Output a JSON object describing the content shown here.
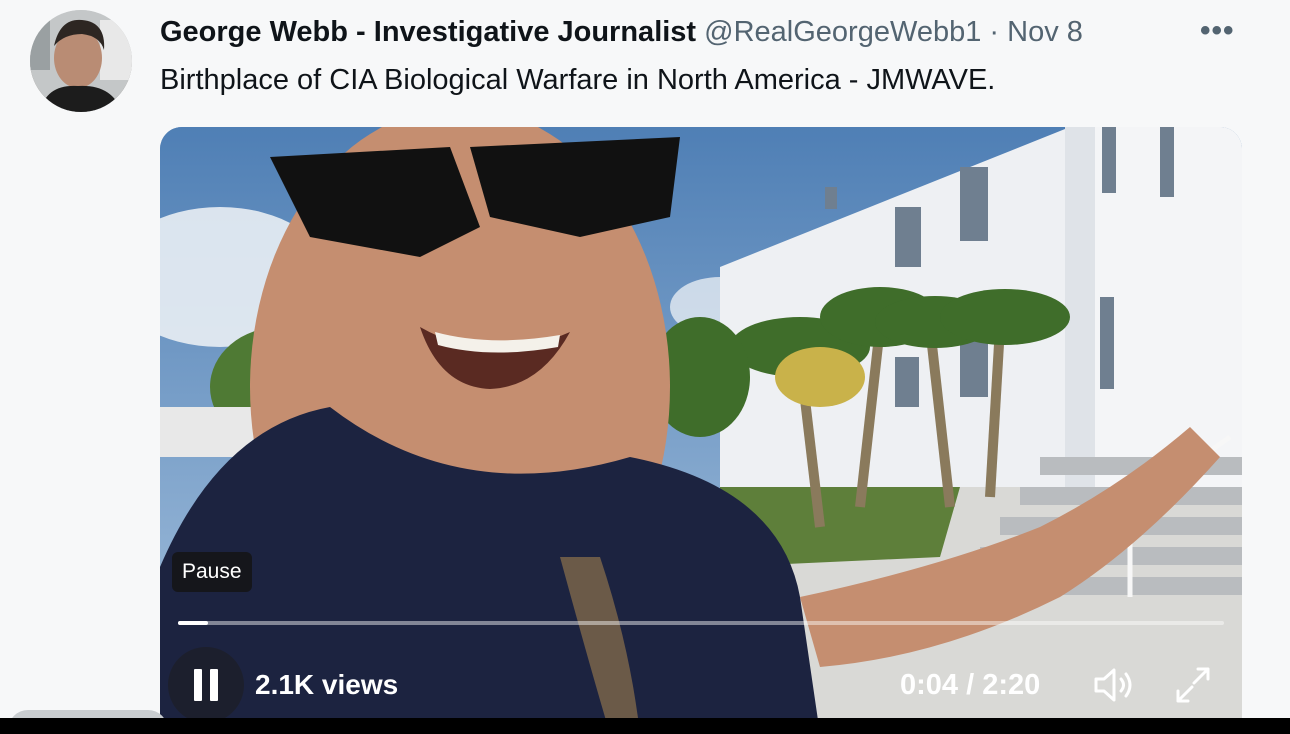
{
  "tweet": {
    "author_name": "George Webb - Investigative Journalist",
    "handle": "@RealGeorgeWebb1",
    "separator": "·",
    "date": "Nov 8",
    "more_icon": "•••",
    "text": "Birthplace of CIA Biological Warfare in North America - JMWAVE."
  },
  "video": {
    "tooltip": "Pause",
    "views": "2.1K views",
    "current_time": "0:04",
    "time_separator": "/",
    "duration": "2:20",
    "progress_fraction": 0.029,
    "icons": {
      "play_pause": "pause-icon",
      "volume": "volume-icon",
      "fullscreen": "fullscreen-icon"
    }
  },
  "colors": {
    "text_primary": "#0f1419",
    "text_secondary": "#536471",
    "background": "#f7f8f9"
  }
}
